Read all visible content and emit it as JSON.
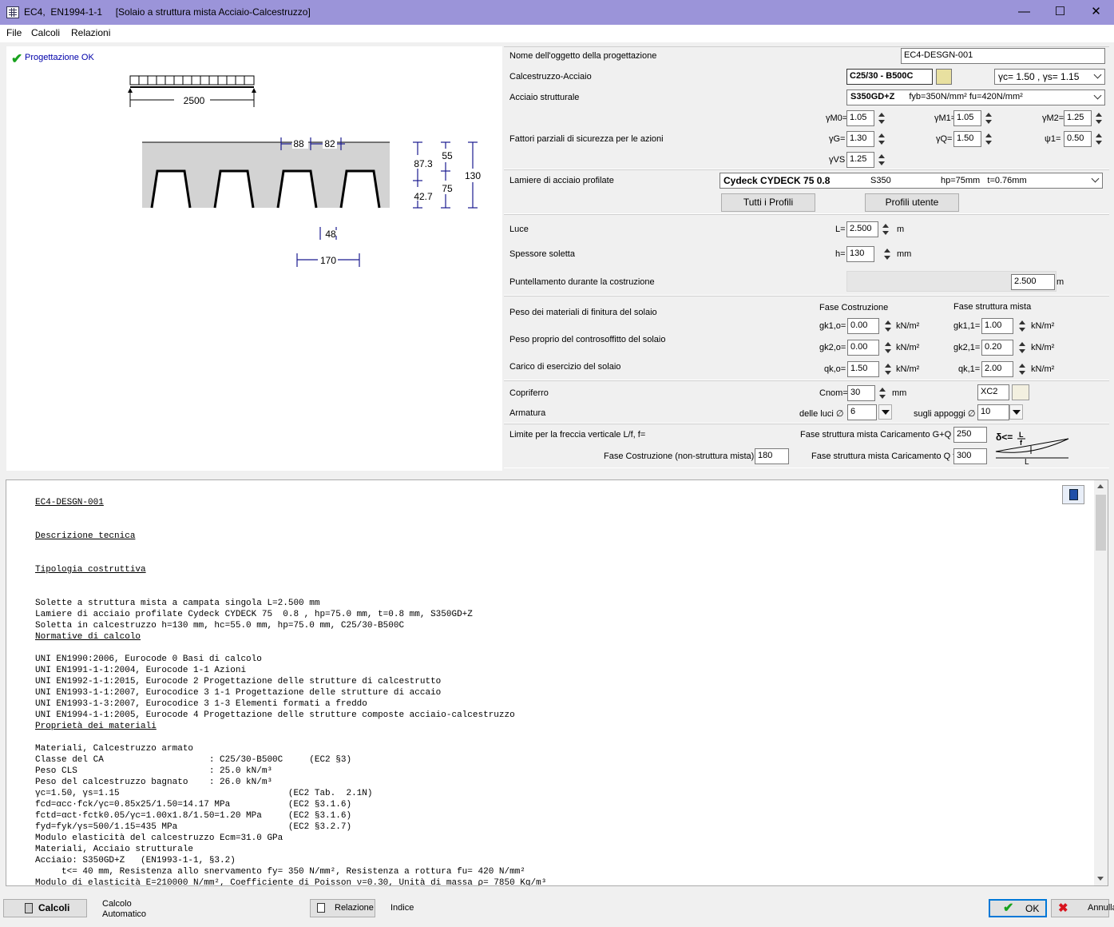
{
  "window": {
    "title": "EC4,  EN1994-1-1     [Solaio a struttura mista Acciaio-Calcestruzzo]"
  },
  "menu": [
    "File",
    "Calcoli",
    "Relazioni"
  ],
  "status": {
    "text": "Progettazione OK"
  },
  "drawing": {
    "span": "2500",
    "rib_top": "88",
    "rib_gap": "82",
    "d1": "87.3",
    "d2": "42.7",
    "d3": "55",
    "d4": "75",
    "d5": "130",
    "d6": "48",
    "d7": "170"
  },
  "form": {
    "nome_label": "Nome dell'oggetto della progettazione",
    "nome_value": "EC4-DESGN-001",
    "cls_label": "Calcestruzzo-Acciaio",
    "cls_value": "C25/30 - B500C",
    "cls_gamma": "γc= 1.50 , γs= 1.15",
    "acc_label": "Acciaio strutturale",
    "acc_value": "S350GD+Z",
    "acc_props": "fyb=350N/mm² fu=420N/mm²",
    "fattori_label": "Fattori parziali di sicurezza per le azioni",
    "gm0_lbl": "γM0=",
    "gm0": "1.05",
    "gm1_lbl": "γM1=",
    "gm1": "1.05",
    "gm2_lbl": "γM2=",
    "gm2": "1.25",
    "gg_lbl": "γG=",
    "gg": "1.30",
    "gq_lbl": "γQ=",
    "gq": "1.50",
    "psi_lbl": "ψ1=",
    "psi": "0.50",
    "gvs_lbl": "γVS",
    "gvs": "1.25",
    "lam_label": "Lamiere di acciaio profilate",
    "lam_name": "Cydeck CYDECK 75 0.8",
    "lam_steel": "S350",
    "lam_dims": "hp=75mm   t=0.76mm",
    "btn_tutti": "Tutti i Profili",
    "btn_utente": "Profili utente",
    "luce_label": "Luce",
    "L_lbl": "L=",
    "L": "2.500",
    "L_unit": "m",
    "sp_label": "Spessore soletta",
    "h_lbl": "h=",
    "h": "130",
    "h_unit": "mm",
    "punt_label": "Puntellamento durante la costruzione",
    "punt": "2.500",
    "punt_unit": "m",
    "fase_costr": "Fase Costruzione",
    "fase_mista": "Fase struttura mista",
    "peso_fin": "Peso dei materiali di finitura del solaio",
    "peso_contro": "Peso proprio del controsoffitto del solaio",
    "carico_es": "Carico di esercizio del solaio",
    "gk1o_lbl": "gk1,o=",
    "gk1o": "0.00",
    "gk11_lbl": "gk1,1=",
    "gk11": "1.00",
    "gk2o_lbl": "gk2,o=",
    "gk2o": "0.00",
    "gk21_lbl": "gk2,1=",
    "gk21": "0.20",
    "qko_lbl": "qk,o=",
    "qko": "1.50",
    "qk1_lbl": "qk,1=",
    "qk1": "2.00",
    "load_unit": "kN/m²",
    "copri_label": "Copriferro",
    "cnom_lbl": "Cnom=",
    "cnom": "30",
    "cnom_unit": "mm",
    "exp": "XC2",
    "arm_label": "Armatura",
    "luci_lbl": "delle luci ∅",
    "luci": "6",
    "app_lbl": "sugli appoggi ∅",
    "app": "10",
    "freccia_label": "Limite per la freccia verticale L/f, f=",
    "fgq_lbl": "Fase struttura mista Caricamento G+Q f=",
    "fgq": "250",
    "fc_lbl": "Fase Costruzione (non-struttura mista) f=",
    "fc": "180",
    "fq_lbl": "Fase struttura mista Caricamento Q f=",
    "fq": "300"
  },
  "bottom": {
    "calcoli": "Calcoli",
    "auto1": "Calcolo",
    "auto2": "Automatico",
    "relazione": "Relazione",
    "indice": "Indice",
    "ok": "OK",
    "annulla": "Annulla"
  }
}
